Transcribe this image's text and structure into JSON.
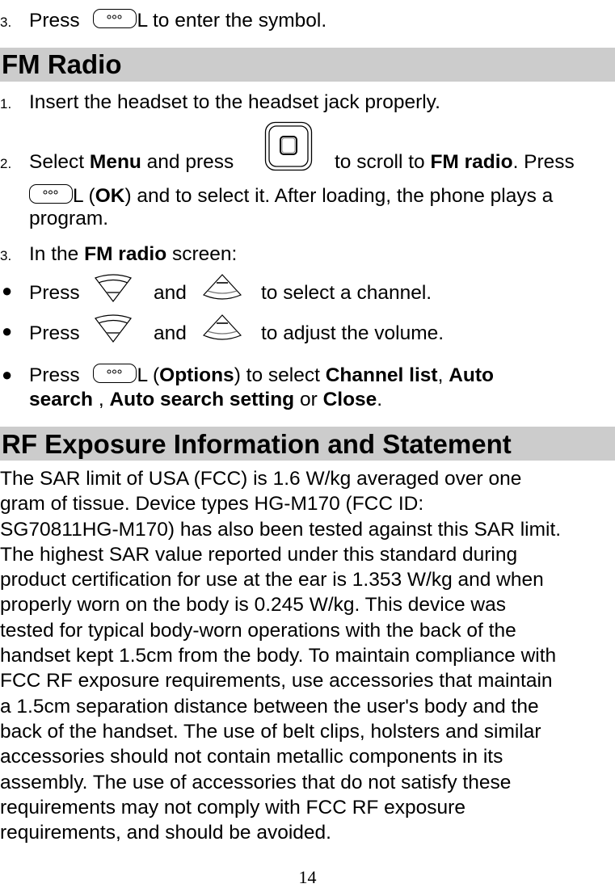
{
  "intro_step": {
    "number": "3.",
    "press": "Press",
    "key_suffix": "L",
    "text": " to enter the symbol."
  },
  "fm_radio": {
    "heading": "FM Radio",
    "steps": [
      {
        "number": "1.",
        "text": "Insert the headset to the headset jack properly."
      },
      {
        "number": "2.",
        "select": "Select ",
        "menu": "Menu",
        "and_press": " and press ",
        "scroll_to": " to scroll to ",
        "fm_radio": "FM radio",
        "press": ". Press",
        "key_suffix": "L (",
        "ok": "OK",
        "after": ") and to select it. After loading, the phone plays a",
        "line3": "program."
      },
      {
        "number": "3.",
        "in_the": "In the ",
        "fm_radio": "FM radio",
        "screen": " screen:"
      }
    ],
    "bullets": [
      {
        "press": "Press",
        "and": "and",
        "text": "to select a channel."
      },
      {
        "press": "Press",
        "and": "and",
        "text": "to adjust the volume."
      },
      {
        "press": "Press",
        "key_suffix": "L (",
        "options": "Options",
        "to_select": ") to select ",
        "channel_list": "Channel list",
        "comma": ", ",
        "auto": "Auto",
        "search": "search",
        "comma2": " , ",
        "auto_search_setting": "Auto search setting",
        "or": " or ",
        "close": "Close",
        "period": "."
      }
    ]
  },
  "rf_exposure": {
    "heading": "RF Exposure Information and Statement",
    "lines": [
      "The SAR limit of USA (FCC) is 1.6 W/kg averaged over one",
      "gram of tissue. Device types HG-M170 (FCC ID:",
      "SG70811HG-M170) has also been tested against this SAR limit.",
      "The highest SAR value reported under this standard during",
      "product certification for use at the ear is 1.353 W/kg and when",
      "properly worn on the body is 0.245 W/kg. This device was",
      "tested for typical body-worn operations with the back of the",
      "handset kept 1.5cm from the body. To maintain compliance with",
      "FCC RF exposure requirements, use accessories that maintain",
      "a 1.5cm separation distance between the user's body and the",
      "back of the handset. The use of belt clips, holsters and similar",
      "accessories should not contain metallic components in its",
      "assembly. The use of accessories that do not satisfy these",
      "requirements may not comply with FCC RF exposure",
      "requirements, and should be avoided."
    ]
  },
  "icons": {
    "left_soft_key": "left-soft-key-icon",
    "nav_key": "navigation-key-icon",
    "down_key": "down-key-icon",
    "up_key": "up-key-icon"
  },
  "page_number": "14"
}
